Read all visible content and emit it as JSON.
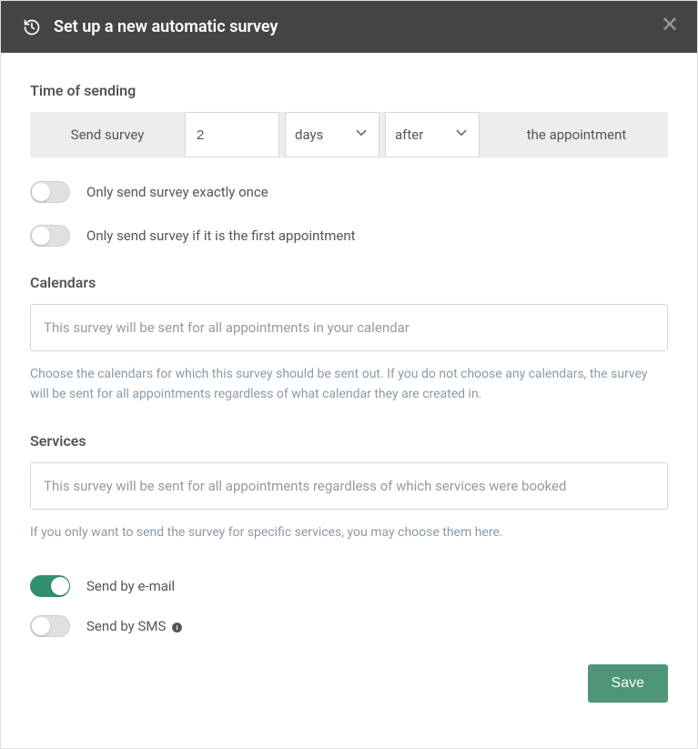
{
  "header": {
    "title": "Set up a new automatic survey"
  },
  "sections": {
    "timeOfSending": {
      "label": "Time of sending",
      "prefix": "Send survey",
      "value": "2",
      "unit": "days",
      "relation": "after",
      "suffix": "the appointment"
    },
    "toggles": {
      "sendOnce": "Only send survey exactly once",
      "firstAppointment": "Only send survey if it is the first appointment",
      "sendEmail": "Send by e-mail",
      "sendSms": "Send by SMS"
    },
    "calendars": {
      "label": "Calendars",
      "placeholder": "This survey will be sent for all appointments in your calendar",
      "help": "Choose the calendars for which this survey should be sent out. If you do not choose any calendars, the survey will be sent for all appointments regardless of what calendar they are created in."
    },
    "services": {
      "label": "Services",
      "placeholder": "This survey will be sent for all appointments regardless of which services were booked",
      "help": "If you only want to send the survey for specific services, you may choose them here."
    }
  },
  "footer": {
    "save": "Save"
  }
}
